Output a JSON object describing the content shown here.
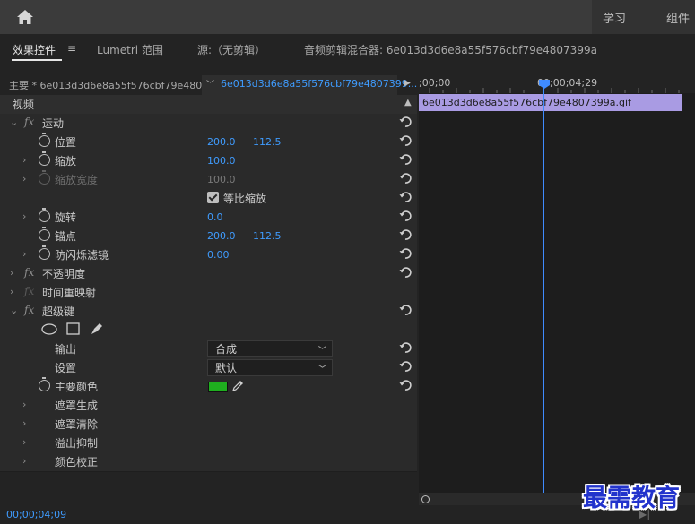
{
  "topbar": {
    "workspaces": [
      "学习",
      "组件"
    ]
  },
  "tabs": [
    {
      "label": "效果控件"
    },
    {
      "label": "Lumetri 范围"
    },
    {
      "label": "源:（无剪辑）"
    },
    {
      "label": "音频剪辑混合器: 6e013d3d6e8a55f576cbf79e4807399a"
    }
  ],
  "source": {
    "master": "主要 * 6e013d3d6e8a55f576cbf79e4807...",
    "clip": "6e013d3d6e8a55f576cbf79e4807399..."
  },
  "section_video": "视频",
  "effects": {
    "motion": "运动",
    "position": {
      "label": "位置",
      "x": "200.0",
      "y": "112.5"
    },
    "scale": {
      "label": "缩放",
      "value": "100.0"
    },
    "scale_width": {
      "label": "缩放宽度",
      "value": "100.0"
    },
    "uniform_scale": "等比缩放",
    "rotation": {
      "label": "旋转",
      "value": "0.0"
    },
    "anchor": {
      "label": "锚点",
      "x": "200.0",
      "y": "112.5"
    },
    "antiflicker": {
      "label": "防闪烁滤镜",
      "value": "0.00"
    },
    "opacity": "不透明度",
    "time_remap": "时间重映射",
    "ultra_key": "超级键",
    "output": {
      "label": "输出",
      "value": "合成"
    },
    "setting": {
      "label": "设置",
      "value": "默认"
    },
    "key_color": {
      "label": "主要颜色",
      "color": "#1fae1f"
    },
    "matte_gen": "遮罩生成",
    "matte_clean": "遮罩清除",
    "spill": "溢出抑制",
    "color_correct": "颜色校正"
  },
  "timeline": {
    "start_tc": ";00;00",
    "mid_tc": "00;00;04;29",
    "clip_name": "6e013d3d6e8a55f576cbf79e4807399a.gif",
    "clip_color": "#a99be3"
  },
  "status_tc": "00;00;04;09",
  "watermark": "最需教育"
}
